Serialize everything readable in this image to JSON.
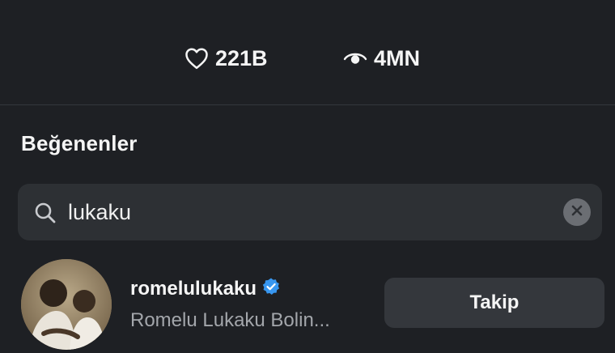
{
  "stats": {
    "likes": {
      "icon": "heart-outline-icon",
      "value": "221B"
    },
    "views": {
      "icon": "eye-icon",
      "value": "4MN"
    }
  },
  "section": {
    "title": "Beğenenler"
  },
  "search": {
    "icon": "search-icon",
    "value": "lukaku",
    "clear_icon": "clear-x-icon"
  },
  "results": [
    {
      "username": "romelulukaku",
      "verified": true,
      "verified_badge_color": "#3897f0",
      "full_name": "Romelu Lukaku Bolin...",
      "follow_label": "Takip"
    }
  ],
  "colors": {
    "background": "#1e2024",
    "search_bg": "#2d3034",
    "button_bg": "#34373c",
    "secondary_text": "#a3a6ab"
  }
}
